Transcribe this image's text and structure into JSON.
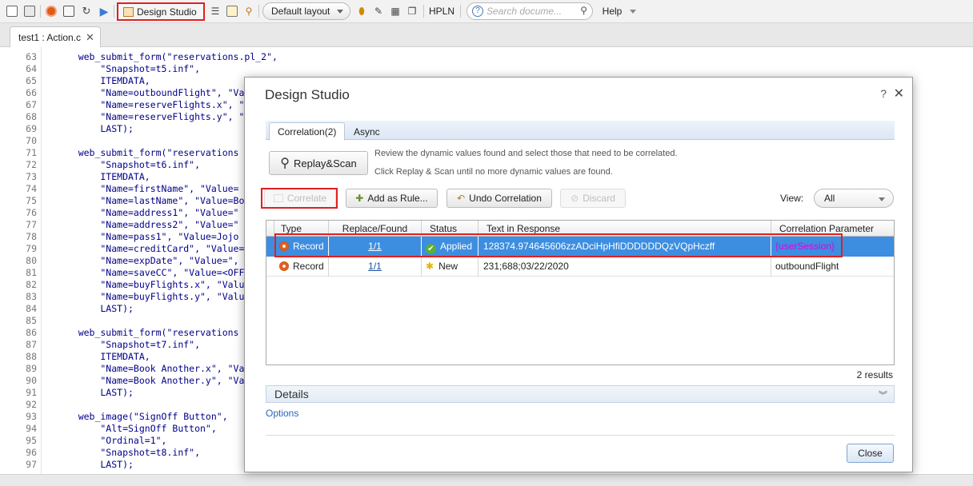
{
  "toolbar": {
    "design_studio_label": "Design Studio",
    "layout_value": "Default layout",
    "hpln_label": "HPLN",
    "search_placeholder": "Search docume...",
    "help_label": "Help"
  },
  "file_tab": {
    "label": "test1 : Action.c"
  },
  "code_lines": [
    {
      "num": "63",
      "code": "    web_submit_form(\"reservations.pl_2\","
    },
    {
      "num": "64",
      "code": "        \"Snapshot=t5.inf\","
    },
    {
      "num": "65",
      "code": "        ITEMDATA,"
    },
    {
      "num": "66",
      "code": "        \"Name=outboundFlight\", \"Va"
    },
    {
      "num": "67",
      "code": "        \"Name=reserveFlights.x\", \""
    },
    {
      "num": "68",
      "code": "        \"Name=reserveFlights.y\", \""
    },
    {
      "num": "69",
      "code": "        LAST);"
    },
    {
      "num": "70",
      "code": ""
    },
    {
      "num": "71",
      "code": "    web_submit_form(\"reservations"
    },
    {
      "num": "72",
      "code": "        \"Snapshot=t6.inf\","
    },
    {
      "num": "73",
      "code": "        ITEMDATA,"
    },
    {
      "num": "74",
      "code": "        \"Name=firstName\", \"Value="
    },
    {
      "num": "75",
      "code": "        \"Name=lastName\", \"Value=Bo"
    },
    {
      "num": "76",
      "code": "        \"Name=address1\", \"Value=\""
    },
    {
      "num": "77",
      "code": "        \"Name=address2\", \"Value=\""
    },
    {
      "num": "78",
      "code": "        \"Name=pass1\", \"Value=Jojo"
    },
    {
      "num": "79",
      "code": "        \"Name=creditCard\", \"Value="
    },
    {
      "num": "80",
      "code": "        \"Name=expDate\", \"Value=\","
    },
    {
      "num": "81",
      "code": "        \"Name=saveCC\", \"Value=<OFF"
    },
    {
      "num": "82",
      "code": "        \"Name=buyFlights.x\", \"Valu"
    },
    {
      "num": "83",
      "code": "        \"Name=buyFlights.y\", \"Valu"
    },
    {
      "num": "84",
      "code": "        LAST);"
    },
    {
      "num": "85",
      "code": ""
    },
    {
      "num": "86",
      "code": "    web_submit_form(\"reservations"
    },
    {
      "num": "87",
      "code": "        \"Snapshot=t7.inf\","
    },
    {
      "num": "88",
      "code": "        ITEMDATA,"
    },
    {
      "num": "89",
      "code": "        \"Name=Book Another.x\", \"Va"
    },
    {
      "num": "90",
      "code": "        \"Name=Book Another.y\", \"Va"
    },
    {
      "num": "91",
      "code": "        LAST);"
    },
    {
      "num": "92",
      "code": ""
    },
    {
      "num": "93",
      "code": "    web_image(\"SignOff Button\","
    },
    {
      "num": "94",
      "code": "        \"Alt=SignOff Button\","
    },
    {
      "num": "95",
      "code": "        \"Ordinal=1\","
    },
    {
      "num": "96",
      "code": "        \"Snapshot=t8.inf\","
    },
    {
      "num": "97",
      "code": "        LAST);"
    }
  ],
  "dialog": {
    "title": "Design Studio",
    "help_glyph": "?",
    "close_glyph": "✕",
    "tabs": [
      {
        "label": "Correlation(2)"
      },
      {
        "label": "Async"
      }
    ],
    "replay_scan_label": "Replay&Scan",
    "hint_line1": "Review the dynamic values found and select those that need to be correlated.",
    "hint_line2": "Click Replay & Scan until no more dynamic values are found.",
    "buttons": {
      "correlate": "Correlate",
      "add_as_rule": "Add as Rule...",
      "undo_correlation": "Undo Correlation",
      "discard": "Discard"
    },
    "view_label": "View:",
    "view_value": "All",
    "columns": [
      "Type",
      "Replace/Found",
      "Status",
      "Text in Response",
      "Correlation Parameter"
    ],
    "rows": [
      {
        "type": "Record",
        "replace_found": "1/1",
        "status": "Applied",
        "text": "128374.974645606zzADciHpHfiDDDDDDQzVQpHczff",
        "param": "{userSession}"
      },
      {
        "type": "Record",
        "replace_found": "1/1",
        "status": "New",
        "text": "231;688;03/22/2020",
        "param": "outboundFlight"
      }
    ],
    "results": "2 results",
    "details_label": "Details",
    "options_label": "Options",
    "close_label": "Close"
  },
  "colors": {
    "selection": "#3d8ee0",
    "highlight_box": "#e02020",
    "param_applied": "#e000e0"
  }
}
